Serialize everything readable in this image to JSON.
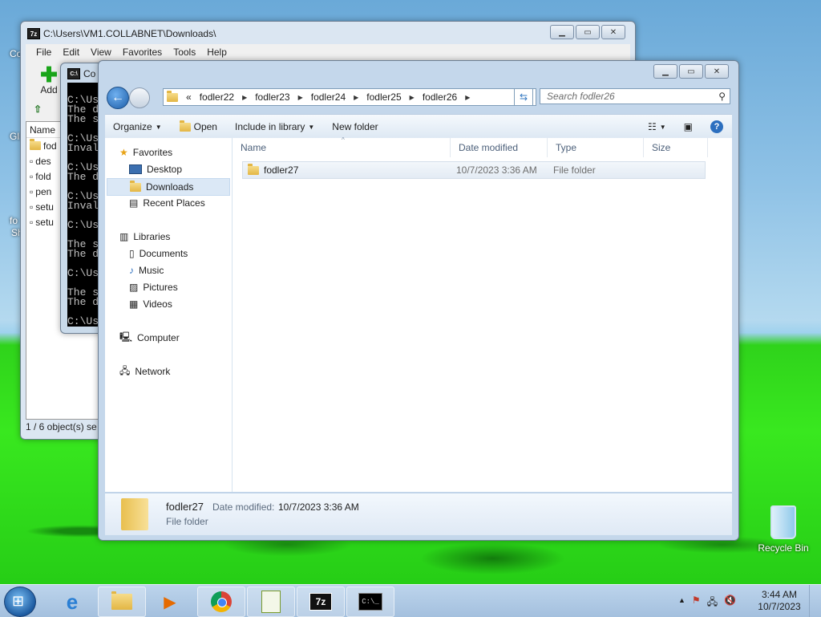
{
  "desktop": {
    "left_icons": [
      "Co",
      "Gli",
      "fo",
      "Sh"
    ],
    "recycle_bin_label": "Recycle Bin"
  },
  "sevenzip": {
    "title": "C:\\Users\\VM1.COLLABNET\\Downloads\\",
    "menu": [
      "File",
      "Edit",
      "View",
      "Favorites",
      "Tools",
      "Help"
    ],
    "add_label": "Add",
    "column_name": "Name",
    "files": [
      "fod",
      "des",
      "fold",
      "pen",
      "setu",
      "setu"
    ],
    "status": "1 / 6 object(s) se"
  },
  "cmd": {
    "title": "Co",
    "lines": [
      "C:\\Us",
      "The d",
      "The s",
      "",
      "C:\\Us",
      "Inval",
      "",
      "C:\\Us",
      "The d",
      "",
      "C:\\Us",
      "Inval",
      "",
      "C:\\Us",
      "",
      "The s",
      "The d",
      "",
      "C:\\Us",
      "",
      "The s",
      "The d",
      "",
      "C:\\Us"
    ]
  },
  "explorer": {
    "breadcrumb_prefix": "«",
    "breadcrumb": [
      "fodler22",
      "fodler23",
      "fodler24",
      "fodler25",
      "fodler26"
    ],
    "search_placeholder": "Search fodler26",
    "commands": {
      "organize": "Organize",
      "open": "Open",
      "include": "Include in library",
      "new_folder": "New folder"
    },
    "nav": {
      "favorites": "Favorites",
      "desktop": "Desktop",
      "downloads": "Downloads",
      "recent": "Recent Places",
      "libraries": "Libraries",
      "documents": "Documents",
      "music": "Music",
      "pictures": "Pictures",
      "videos": "Videos",
      "computer": "Computer",
      "network": "Network"
    },
    "columns": [
      "Name",
      "Date modified",
      "Type",
      "Size"
    ],
    "rows": [
      {
        "name": "fodler27",
        "date": "10/7/2023 3:36 AM",
        "type": "File folder",
        "size": ""
      }
    ],
    "details": {
      "name": "fodler27",
      "date_label": "Date modified:",
      "date_value": "10/7/2023 3:36 AM",
      "type": "File folder"
    }
  },
  "taskbar": {
    "clock_time": "3:44 AM",
    "clock_date": "10/7/2023",
    "sevenzip_label": "7z"
  },
  "colors": {
    "accent": "#1d5ea8",
    "grass": "#39e81f",
    "selection": "#dbe8f6"
  }
}
